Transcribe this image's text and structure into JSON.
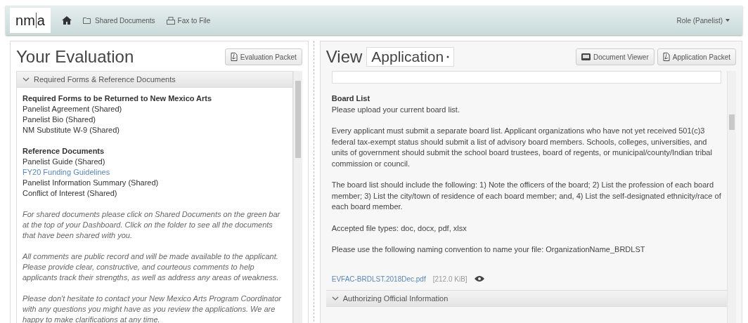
{
  "nav": {
    "logo": {
      "left": "nm",
      "right": "a"
    },
    "items": [
      {
        "kind": "home"
      },
      {
        "kind": "folder",
        "label": "Shared Documents"
      },
      {
        "kind": "fax",
        "label": "Fax to File"
      }
    ],
    "role_menu": "Role (Panelist)"
  },
  "evaluation": {
    "title": "Your Evaluation",
    "packet_button": "Evaluation Packet",
    "accordion": {
      "title": "Required Forms & Reference Documents",
      "expanded": true,
      "sections": [
        {
          "heading": "Required Forms to be Returned to New Mexico Arts",
          "items": [
            {
              "text": "Panelist Agreement (Shared)",
              "kind": "plain"
            },
            {
              "text": "Panelist Bio (Shared)",
              "kind": "plain"
            },
            {
              "text": "NM Substitute W-9 (Shared)",
              "kind": "plain"
            }
          ]
        },
        {
          "heading": "Reference Documents",
          "items": [
            {
              "text": "Panelist Guide (Shared)",
              "kind": "plain"
            },
            {
              "text": "FY20 Funding Guidelines",
              "kind": "link"
            },
            {
              "text": "Panelist Information Summary (Shared)",
              "kind": "plain"
            },
            {
              "text": "Conflict of Interest (Shared)",
              "kind": "plain"
            }
          ]
        }
      ],
      "notes": [
        "For shared documents please click on Shared Documents on the green bar at the top of your Dashboard. Click on the folder to see all the documents that have been shared with you.",
        "All comments are public record and will be made available to the applicant. Please provide clear, constructive, and courteous comments to help applicants track their strengths, as well as address any areas of weakness.",
        "Please don't hesitate to contact your New Mexico Arts Program Coordinator with any questions you might have as you review the applications. We are happy to make clarifications at any time."
      ]
    }
  },
  "application": {
    "title": "View",
    "select": "Application",
    "buttons": [
      {
        "kind": "viewer",
        "label": "Document Viewer"
      },
      {
        "kind": "pdf",
        "label": "Application Packet"
      }
    ],
    "board_list": {
      "heading": "Board List",
      "paragraphs": [
        "Please upload your current board list.",
        "Every applicant must submit a separate board list. Applicant organizations who have not yet received 501(c)3 federal tax-exempt status should submit a list of advisory board members. Schools, colleges, universities, and units of government should submit the school board trustees, board of regents, or municipal/county/Indian tribal commission or council.",
        "The board list should include the following: 1) Note the officers of the board; 2) List the profession of each board member; 3) List the city/town of residence of each board member; and, 4) List the self-designated ethnicity/race of each board member.",
        "Accepted file types: doc, docx, pdf, xlsx",
        "Please use the following naming convention to name your file: OrganizationName_BRDLST"
      ],
      "file": {
        "name": "EVFAC-BRDLST.2018Dec.pdf",
        "size": "[212.0 KiB]"
      }
    },
    "next_section": {
      "title": "Authorizing Official Information",
      "expanded": true
    }
  }
}
